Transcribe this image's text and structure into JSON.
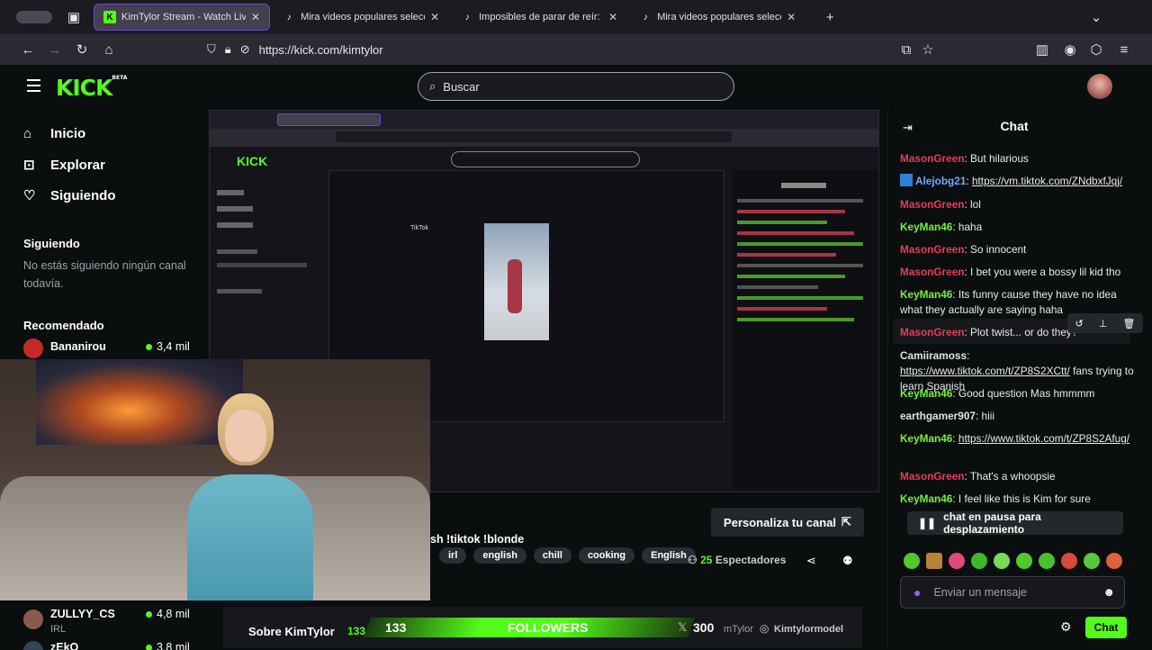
{
  "browser": {
    "tabs": [
      {
        "label": "KimTylor Stream - Watch Live on Kick",
        "favicon": "kick-icon",
        "active": true
      },
      {
        "label": "Mira videos populares seleccion",
        "favicon": "tiktok-icon",
        "active": false
      },
      {
        "label": "Imposibles de parar de reír: mon",
        "favicon": "tiktok-icon",
        "active": false
      },
      {
        "label": "Mira videos populares seleccion",
        "favicon": "tiktok-icon",
        "active": false
      }
    ],
    "new_tab": "+",
    "url": "https://kick.com/kimtylor"
  },
  "header": {
    "logo": "KICK",
    "logo_badge": "BETA",
    "search_placeholder": "Buscar"
  },
  "sidebar": {
    "nav": [
      {
        "label": "Inicio",
        "icon": "home-icon"
      },
      {
        "label": "Explorar",
        "icon": "compass-icon"
      },
      {
        "label": "Siguiendo",
        "icon": "heart-icon"
      }
    ],
    "following_title": "Siguiendo",
    "following_empty": "No estás siguiendo ningún canal todavía.",
    "recommended_title": "Recomendado",
    "recommended": [
      {
        "name": "Bananirou",
        "viewers": "3,4 mil"
      },
      {
        "name": "ZULLYY_CS",
        "category": "IRL",
        "viewers": "4,8 mil"
      },
      {
        "name": "zEkO",
        "viewers": "3,8 mil"
      }
    ]
  },
  "stream": {
    "title_fragment": "sh !tiktok !blonde",
    "tags": [
      "irl",
      "english",
      "chill",
      "cooking",
      "English"
    ],
    "customize_label": "Personaliza tu canal",
    "viewers_count": "25",
    "viewers_label": "Espectadores",
    "about_label": "Sobre KimTylor",
    "followers_goal": "133",
    "followers_label": "FOLLOWERS",
    "followers_target": "300",
    "social_handle": "Kimtylormodel",
    "social_handle_short": "mTylor",
    "tiktok_nested_label": "TikTok"
  },
  "chat": {
    "title": "Chat",
    "messages": [
      {
        "user": "MasonGreen",
        "color": "red",
        "text": "But hilarious"
      },
      {
        "user": "Alejobg21",
        "color": "blue",
        "text": "https://vm.tiktok.com/ZNdbxfJqj/",
        "link": true
      },
      {
        "user": "MasonGreen",
        "color": "red",
        "text": "lol"
      },
      {
        "user": "KeyMan46",
        "color": "green",
        "text": "haha"
      },
      {
        "user": "MasonGreen",
        "color": "red",
        "text": "So innocent"
      },
      {
        "user": "MasonGreen",
        "color": "red",
        "text": "I bet you were a bossy lil kid tho"
      },
      {
        "user": "KeyMan46",
        "color": "green",
        "text": "Its funny cause they have no idea what they actually are saying haha"
      },
      {
        "user": "MasonGreen",
        "color": "red",
        "text": "Plot twist... or do they?"
      },
      {
        "user": "Camiiramoss",
        "color": "grey",
        "text": "https://www.tiktok.com/t/ZP8S2XCtt/",
        "link": true,
        "suffix": "fans trying to learn Spanish"
      },
      {
        "user": "KeyMan46",
        "color": "green",
        "text": "Good question Mas hmmmm"
      },
      {
        "user": "earthgamer907",
        "color": "grey",
        "text": "hiii"
      },
      {
        "user": "KeyMan46",
        "color": "green",
        "text": "https://www.tiktok.com/t/ZP8S2Afug/",
        "link": true
      },
      {
        "user": "MasonGreen",
        "color": "red",
        "text": "That's a whoopsie"
      },
      {
        "user": "KeyMan46",
        "color": "green",
        "text": "I feel like this is Kim for sure"
      }
    ],
    "paused_label": "chat en pausa para desplazamiento",
    "input_placeholder": "Enviar un mensaje",
    "send_label": "Chat"
  },
  "colors": {
    "kick_green": "#53fc18",
    "user_red": "#e23f54",
    "user_green": "#72f23e"
  }
}
